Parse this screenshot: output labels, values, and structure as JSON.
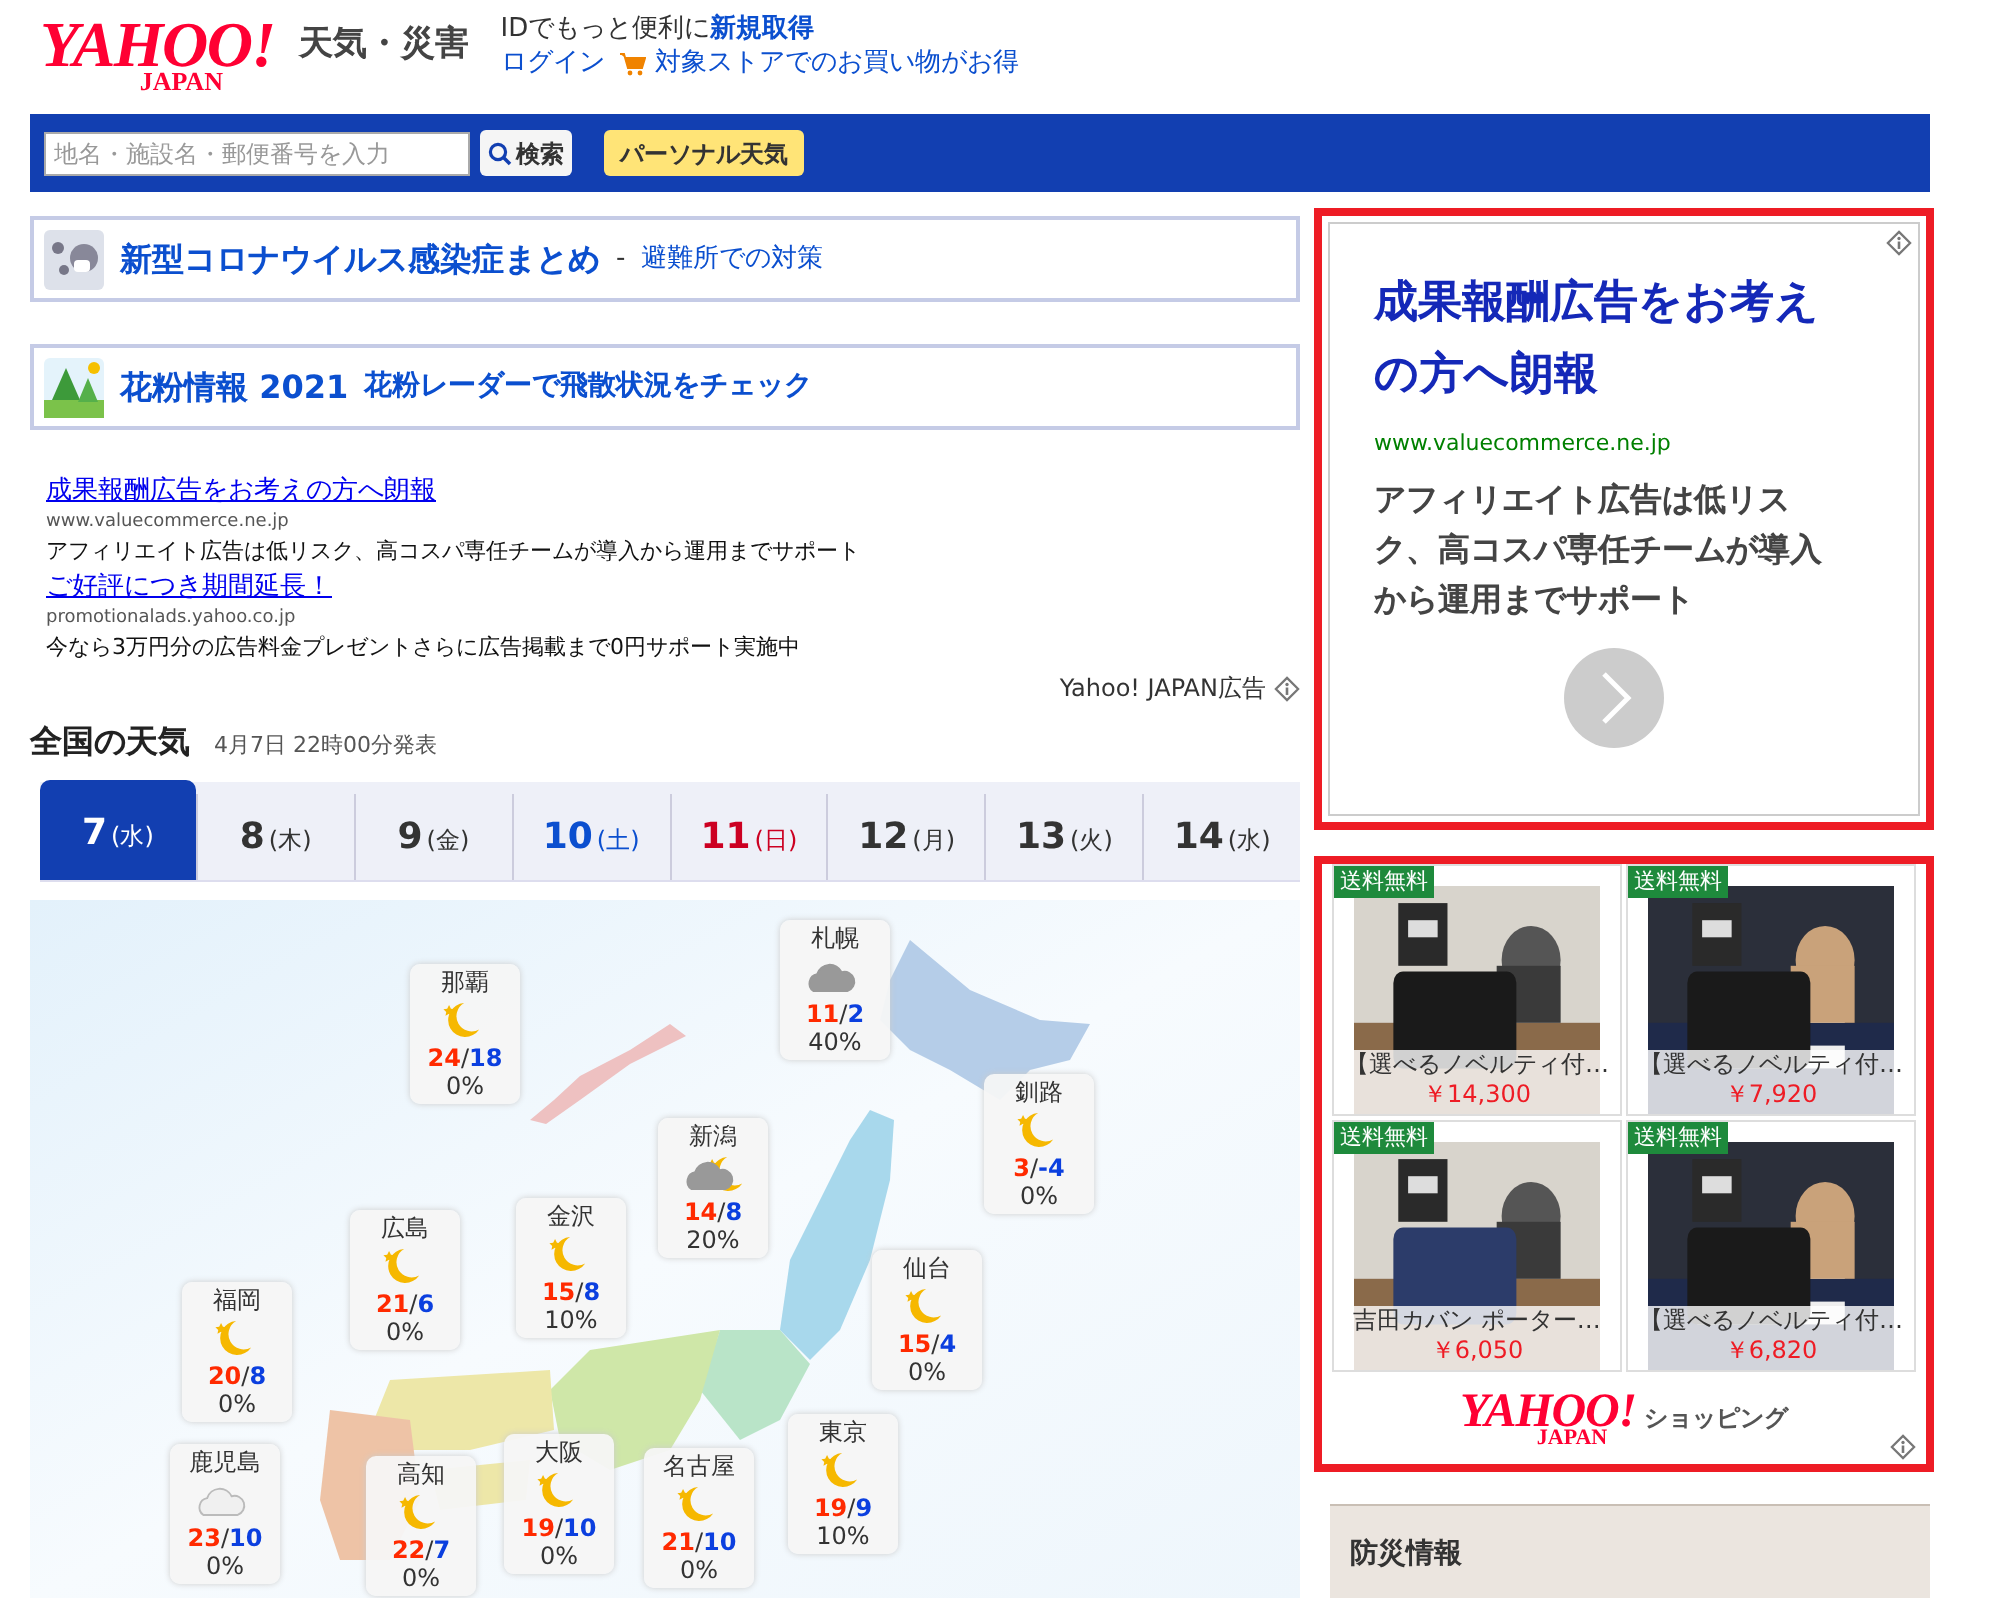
{
  "header": {
    "logo": {
      "main": "YAHOO!",
      "sub": "JAPAN"
    },
    "service_title": "天気・災害",
    "id_text": "IDでもっと便利に",
    "signup_link": "新規取得",
    "login_link": "ログイン",
    "store_link": "対象ストアでのお買い物がお得"
  },
  "search_bar": {
    "placeholder": "地名・施設名・郵便番号を入力",
    "search_button": "検索",
    "personal_button": "パーソナル天気"
  },
  "banners": [
    {
      "kind": "covid",
      "title": "新型コロナウイルス感染症まとめ",
      "dash": "-",
      "subtitle": "避難所での対策"
    },
    {
      "kind": "pollen",
      "title": "花粉情報 2021",
      "subtitle": "花粉レーダーで飛散状況をチェック"
    }
  ],
  "text_ads": [
    {
      "title": "成果報酬広告をお考えの方へ朗報",
      "url": "www.valuecommerce.ne.jp",
      "description": "アフィリエイト広告は低リスク、高コスパ専任チームが導入から運用までサポート"
    },
    {
      "title": "ご好評につき期間延長！",
      "url": "promotionalads.yahoo.co.jp",
      "description": "今なら3万円分の広告料金プレゼントさらに広告掲載まで0円サポート実施中"
    }
  ],
  "ad_label": "Yahoo! JAPAN広告",
  "weather": {
    "title": "全国の天気",
    "issued": "4月7日 22時00分発表",
    "days": [
      {
        "day": "7",
        "weekday": "(水)",
        "kind": "weekday",
        "selected": true
      },
      {
        "day": "8",
        "weekday": "(木)",
        "kind": "weekday",
        "selected": false
      },
      {
        "day": "9",
        "weekday": "(金)",
        "kind": "weekday",
        "selected": false
      },
      {
        "day": "10",
        "weekday": "(土)",
        "kind": "saturday",
        "selected": false
      },
      {
        "day": "11",
        "weekday": "(日)",
        "kind": "sunday",
        "selected": false
      },
      {
        "day": "12",
        "weekday": "(月)",
        "kind": "weekday",
        "selected": false
      },
      {
        "day": "13",
        "weekday": "(火)",
        "kind": "weekday",
        "selected": false
      },
      {
        "day": "14",
        "weekday": "(水)",
        "kind": "weekday",
        "selected": false
      }
    ],
    "cities": [
      {
        "name": "那覇",
        "kind": "moon",
        "high": "24",
        "sep": "/",
        "low": "18",
        "rain": "0%"
      },
      {
        "name": "札幌",
        "kind": "cloud",
        "high": "11",
        "sep": "/",
        "low": "2",
        "rain": "40%"
      },
      {
        "name": "新潟",
        "kind": "cloud_moon",
        "high": "14",
        "sep": "/",
        "low": "8",
        "rain": "20%"
      },
      {
        "name": "釧路",
        "kind": "moon",
        "high": "3",
        "sep": "/",
        "low": "-4",
        "rain": "0%"
      },
      {
        "name": "福岡",
        "kind": "moon",
        "high": "20",
        "sep": "/",
        "low": "8",
        "rain": "0%"
      },
      {
        "name": "広島",
        "kind": "moon",
        "high": "21",
        "sep": "/",
        "low": "6",
        "rain": "0%"
      },
      {
        "name": "金沢",
        "kind": "moon",
        "high": "15",
        "sep": "/",
        "low": "8",
        "rain": "10%"
      },
      {
        "name": "仙台",
        "kind": "moon",
        "high": "15",
        "sep": "/",
        "low": "4",
        "rain": "0%"
      },
      {
        "name": "鹿児島",
        "kind": "light_cloud",
        "high": "23",
        "sep": "/",
        "low": "10",
        "rain": "0%"
      },
      {
        "name": "高知",
        "kind": "moon",
        "high": "22",
        "sep": "/",
        "low": "7",
        "rain": "0%"
      },
      {
        "name": "大阪",
        "kind": "moon",
        "high": "19",
        "sep": "/",
        "low": "10",
        "rain": "0%"
      },
      {
        "name": "名古屋",
        "kind": "moon",
        "high": "21",
        "sep": "/",
        "low": "10",
        "rain": "0%"
      },
      {
        "name": "東京",
        "kind": "moon",
        "high": "19",
        "sep": "/",
        "low": "9",
        "rain": "10%"
      }
    ]
  },
  "display_ad": {
    "title": "成果報酬広告をお考えの方へ朗報",
    "url": "www.valuecommerce.ne.jp",
    "description": "アフィリエイト広告は低リスク、高コスパ専任チームが導入から運用までサポート"
  },
  "shopping_ad": {
    "products": [
      {
        "badge": "送料無料",
        "name": "【選べるノベルティ付…",
        "price": "￥14,300",
        "kind": "picture"
      },
      {
        "badge": "送料無料",
        "name": "【選べるノベルティ付…",
        "price": "￥7,920",
        "kind": "picture"
      },
      {
        "badge": "送料無料",
        "name": "吉田カバン ポーター…",
        "price": "￥6,050",
        "kind": "picture"
      },
      {
        "badge": "送料無料",
        "name": "【選べるノベルティ付…",
        "price": "￥6,820",
        "kind": "picture"
      }
    ],
    "logo": {
      "main": "YAHOO!",
      "sub": "JAPAN"
    },
    "service": "ショッピング"
  },
  "disaster_panel": {
    "title": "防災情報"
  }
}
